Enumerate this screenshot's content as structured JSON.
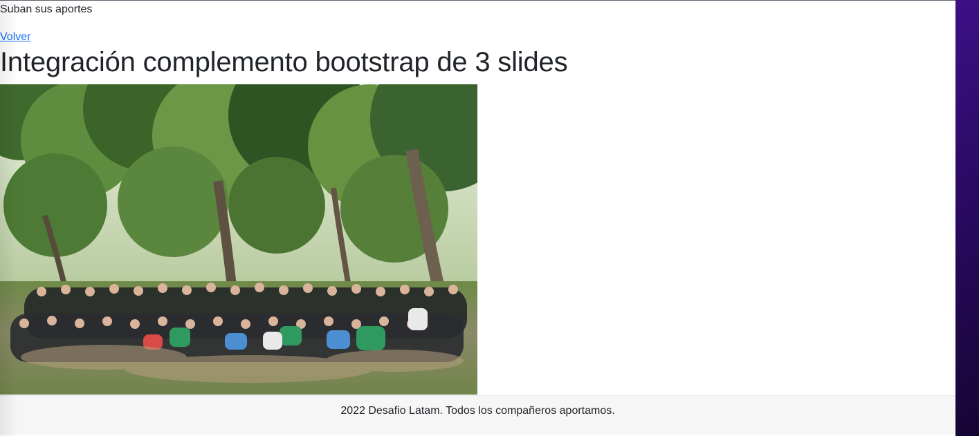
{
  "header": {
    "nav_text": "Suban sus aportes"
  },
  "main": {
    "back_link": "Volver",
    "title": "Integración complemento bootstrap de 3 slides"
  },
  "footer": {
    "text": "2022 Desafio Latam. Todos los compañeros aportamos."
  },
  "colors": {
    "link": "#0d6efd",
    "text": "#212529",
    "footer_bg": "#f6f6f6",
    "desktop_accent": "#3d0f85"
  }
}
